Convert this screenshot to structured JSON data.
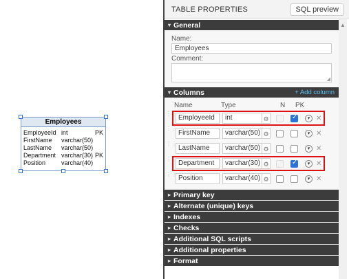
{
  "entity": {
    "title": "Employees",
    "rows": [
      {
        "name": "EmployeeId",
        "type": "int",
        "pk": "PK"
      },
      {
        "name": "FirstName",
        "type": "varchar(50)",
        "pk": ""
      },
      {
        "name": "LastName",
        "type": "varchar(50)",
        "pk": ""
      },
      {
        "name": "Department",
        "type": "varchar(30)",
        "pk": "PK"
      },
      {
        "name": "Position",
        "type": "varchar(40)",
        "pk": ""
      }
    ]
  },
  "panel": {
    "title": "TABLE PROPERTIES",
    "sql_preview": "SQL preview",
    "general": {
      "header": "General",
      "name_label": "Name:",
      "name_value": "Employees",
      "comment_label": "Comment:"
    },
    "columns": {
      "header": "Columns",
      "add_label": "+ Add column",
      "headers": {
        "name": "Name",
        "type": "Type",
        "n": "N",
        "pk": "PK"
      },
      "rows": [
        {
          "name": "EmployeeId",
          "type": "int",
          "nullable": false,
          "pk": true
        },
        {
          "name": "FirstName",
          "type": "varchar(50)",
          "nullable": false,
          "pk": false
        },
        {
          "name": "LastName",
          "type": "varchar(50)",
          "nullable": false,
          "pk": false
        },
        {
          "name": "Department",
          "type": "varchar(30)",
          "nullable": false,
          "pk": true
        },
        {
          "name": "Position",
          "type": "varchar(40)",
          "nullable": false,
          "pk": false
        }
      ]
    },
    "sections": [
      "Primary key",
      "Alternate (unique) keys",
      "Indexes",
      "Checks",
      "Additional SQL scripts",
      "Additional properties",
      "Format"
    ]
  },
  "colors": {
    "accent": "#2a74d9",
    "highlight": "#dd1111",
    "section_bg": "#3c3c3c"
  }
}
